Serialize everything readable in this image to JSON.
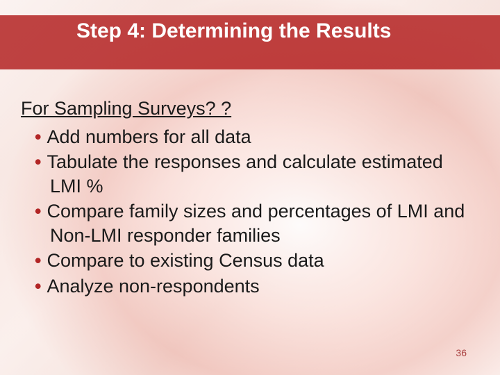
{
  "title": "Step 4: Determining the Results",
  "subhead": "For Sampling Surveys? ?",
  "bullets": [
    "Add numbers for all data",
    "Tabulate the responses and calculate estimated LMI %",
    "Compare family sizes and percentages of LMI and Non-LMI responder families",
    "Compare to existing Census data",
    "Analyze non-respondents"
  ],
  "page_number": "36"
}
